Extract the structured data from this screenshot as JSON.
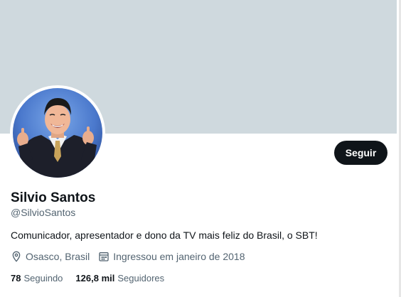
{
  "profile": {
    "name": "Silvio Santos",
    "handle": "@SilvioSantos",
    "bio": "Comunicador, apresentador e dono da TV mais feliz do Brasil, o SBT!",
    "location": "Osasco, Brasil",
    "joined": "Ingressou em janeiro de 2018",
    "following_count": "78",
    "following_label": "Seguindo",
    "followers_count": "126,8 mil",
    "followers_label": "Seguidores"
  },
  "actions": {
    "follow_label": "Seguir"
  },
  "icons": {
    "location": "location-pin-icon",
    "joined": "calendar-icon"
  },
  "colors": {
    "banner": "#cfd9de",
    "button": "#0f1419",
    "secondary_text": "#536471"
  }
}
